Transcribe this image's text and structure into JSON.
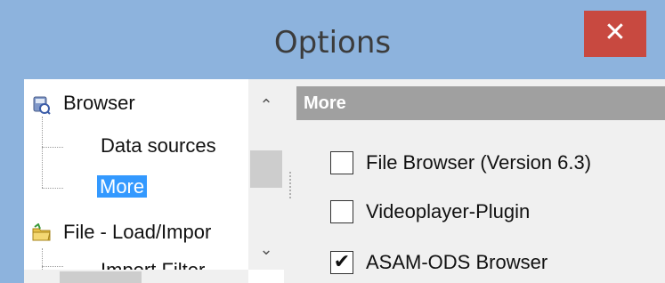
{
  "window": {
    "title": "Options",
    "close_glyph": "✕"
  },
  "tree": {
    "items": [
      {
        "label": "Browser",
        "icon": "database-icon"
      },
      {
        "label": "Data sources"
      },
      {
        "label": "More",
        "selected": true
      },
      {
        "label": "File - Load/Impor",
        "icon": "folder-icon"
      },
      {
        "label": "Import Filter"
      }
    ],
    "scroll_up_glyph": "⌃",
    "scroll_down_glyph": "⌄"
  },
  "panel": {
    "header": "More",
    "options": [
      {
        "label": "File Browser (Version 6.3)",
        "checked": false,
        "mark": ""
      },
      {
        "label": "Videoplayer-Plugin",
        "checked": false,
        "mark": ""
      },
      {
        "label": "ASAM-ODS Browser",
        "checked": true,
        "mark": "✔"
      }
    ]
  },
  "colors": {
    "titlebar": "#8db3dd",
    "close_button": "#c84940",
    "selection": "#3399ff",
    "section_header": "#a0a0a0"
  }
}
